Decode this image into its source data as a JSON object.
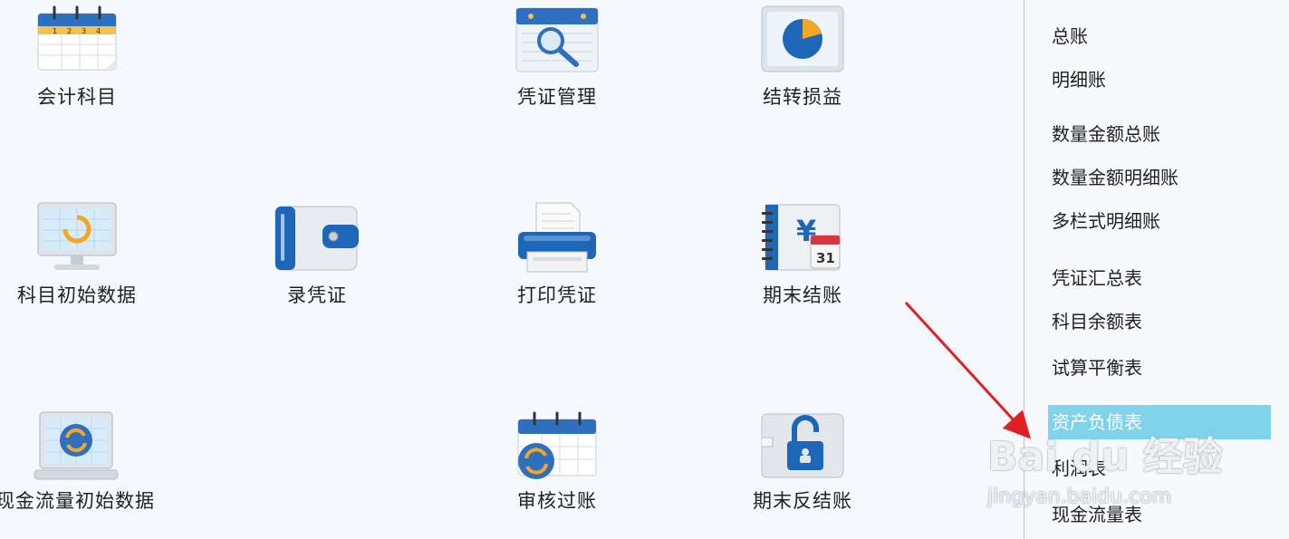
{
  "tiles": {
    "accounts": {
      "label": "会计科目"
    },
    "voucher_mgmt": {
      "label": "凭证管理"
    },
    "carry_forward": {
      "label": "结转损益"
    },
    "initial_data": {
      "label": "科目初始数据"
    },
    "enter_voucher": {
      "label": "录凭证"
    },
    "print_voucher": {
      "label": "打印凭证"
    },
    "period_close": {
      "label": "期末结账"
    },
    "cashflow_initial": {
      "label": "现金流量初始数据"
    },
    "review_post": {
      "label": "审核过账"
    },
    "period_unclose": {
      "label": "期末反结账"
    }
  },
  "sidebar": {
    "items": [
      {
        "label": "总账"
      },
      {
        "label": "明细账"
      },
      {
        "label": "数量金额总账"
      },
      {
        "label": "数量金额明细账"
      },
      {
        "label": "多栏式明细账"
      },
      {
        "label": "凭证汇总表"
      },
      {
        "label": "科目余额表"
      },
      {
        "label": "试算平衡表"
      },
      {
        "label": "资产负债表"
      },
      {
        "label": "利润表"
      },
      {
        "label": "现金流量表"
      }
    ],
    "selected_index": 8
  },
  "calendar_days": [
    "1",
    "2",
    "3",
    "4"
  ],
  "close_icon_day": "31",
  "currency_symbol": "¥",
  "watermark": {
    "main": "Bai du 经验",
    "sub": "jingyan.baidu.com"
  },
  "colors": {
    "selected_bg": "#7fd3ea",
    "arrow": "#e02020",
    "icon_blue": "#1e66b8"
  }
}
